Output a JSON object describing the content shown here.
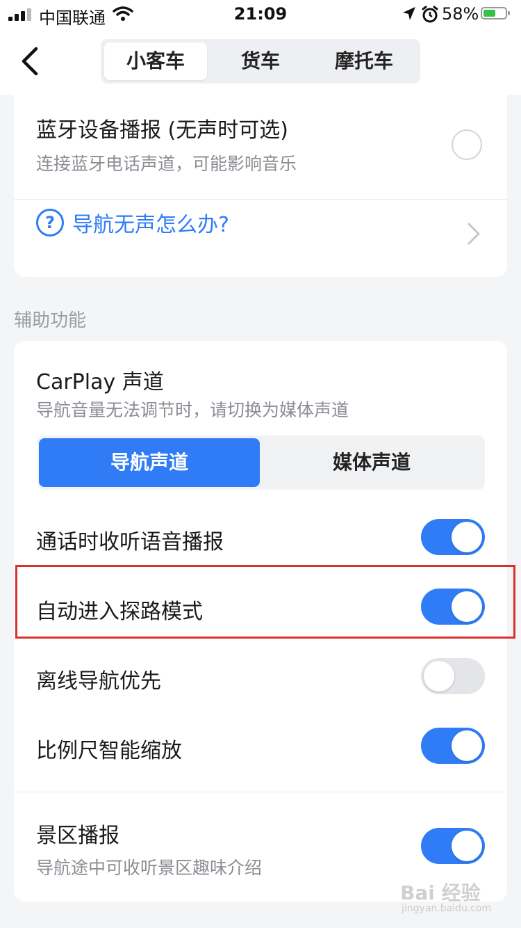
{
  "status_bar": {
    "carrier": "中国联通",
    "time": "21:09",
    "battery_percent": "58%",
    "battery_level": 0.58,
    "icons": [
      "signal-icon",
      "wifi-icon",
      "location-icon",
      "alarm-icon",
      "battery-icon"
    ]
  },
  "header": {
    "tabs": [
      {
        "label": "小客车",
        "active": true
      },
      {
        "label": "货车",
        "active": false
      },
      {
        "label": "摩托车",
        "active": false
      }
    ]
  },
  "bluetooth": {
    "title": "蓝牙设备播报 (无声时可选)",
    "subtitle": "连接蓝牙电话声道，可能影响音乐",
    "selected": false
  },
  "help": {
    "label": "导航无声怎么办?",
    "icon_glyph": "?"
  },
  "section": {
    "label": "辅助功能"
  },
  "carplay": {
    "title": "CarPlay 声道",
    "subtitle": "导航音量无法调节时，请切换为媒体声道",
    "options": [
      {
        "label": "导航声道",
        "selected": true
      },
      {
        "label": "媒体声道",
        "selected": false
      }
    ]
  },
  "toggles": [
    {
      "label": "通话时收听语音播报",
      "on": true
    },
    {
      "label": "自动进入探路模式",
      "on": true
    },
    {
      "label": "离线导航优先",
      "on": false
    },
    {
      "label": "比例尺智能缩放",
      "on": true
    }
  ],
  "scenic": {
    "title": "景区播报",
    "subtitle": "导航途中可收听景区趣味介绍",
    "on": true
  },
  "colors": {
    "accent": "#2f7cf6",
    "highlight": "#d9312b",
    "battery": "#36c24a"
  },
  "watermark": {
    "text": "Bai 经验",
    "sub": "jingyan.baidu.com"
  }
}
